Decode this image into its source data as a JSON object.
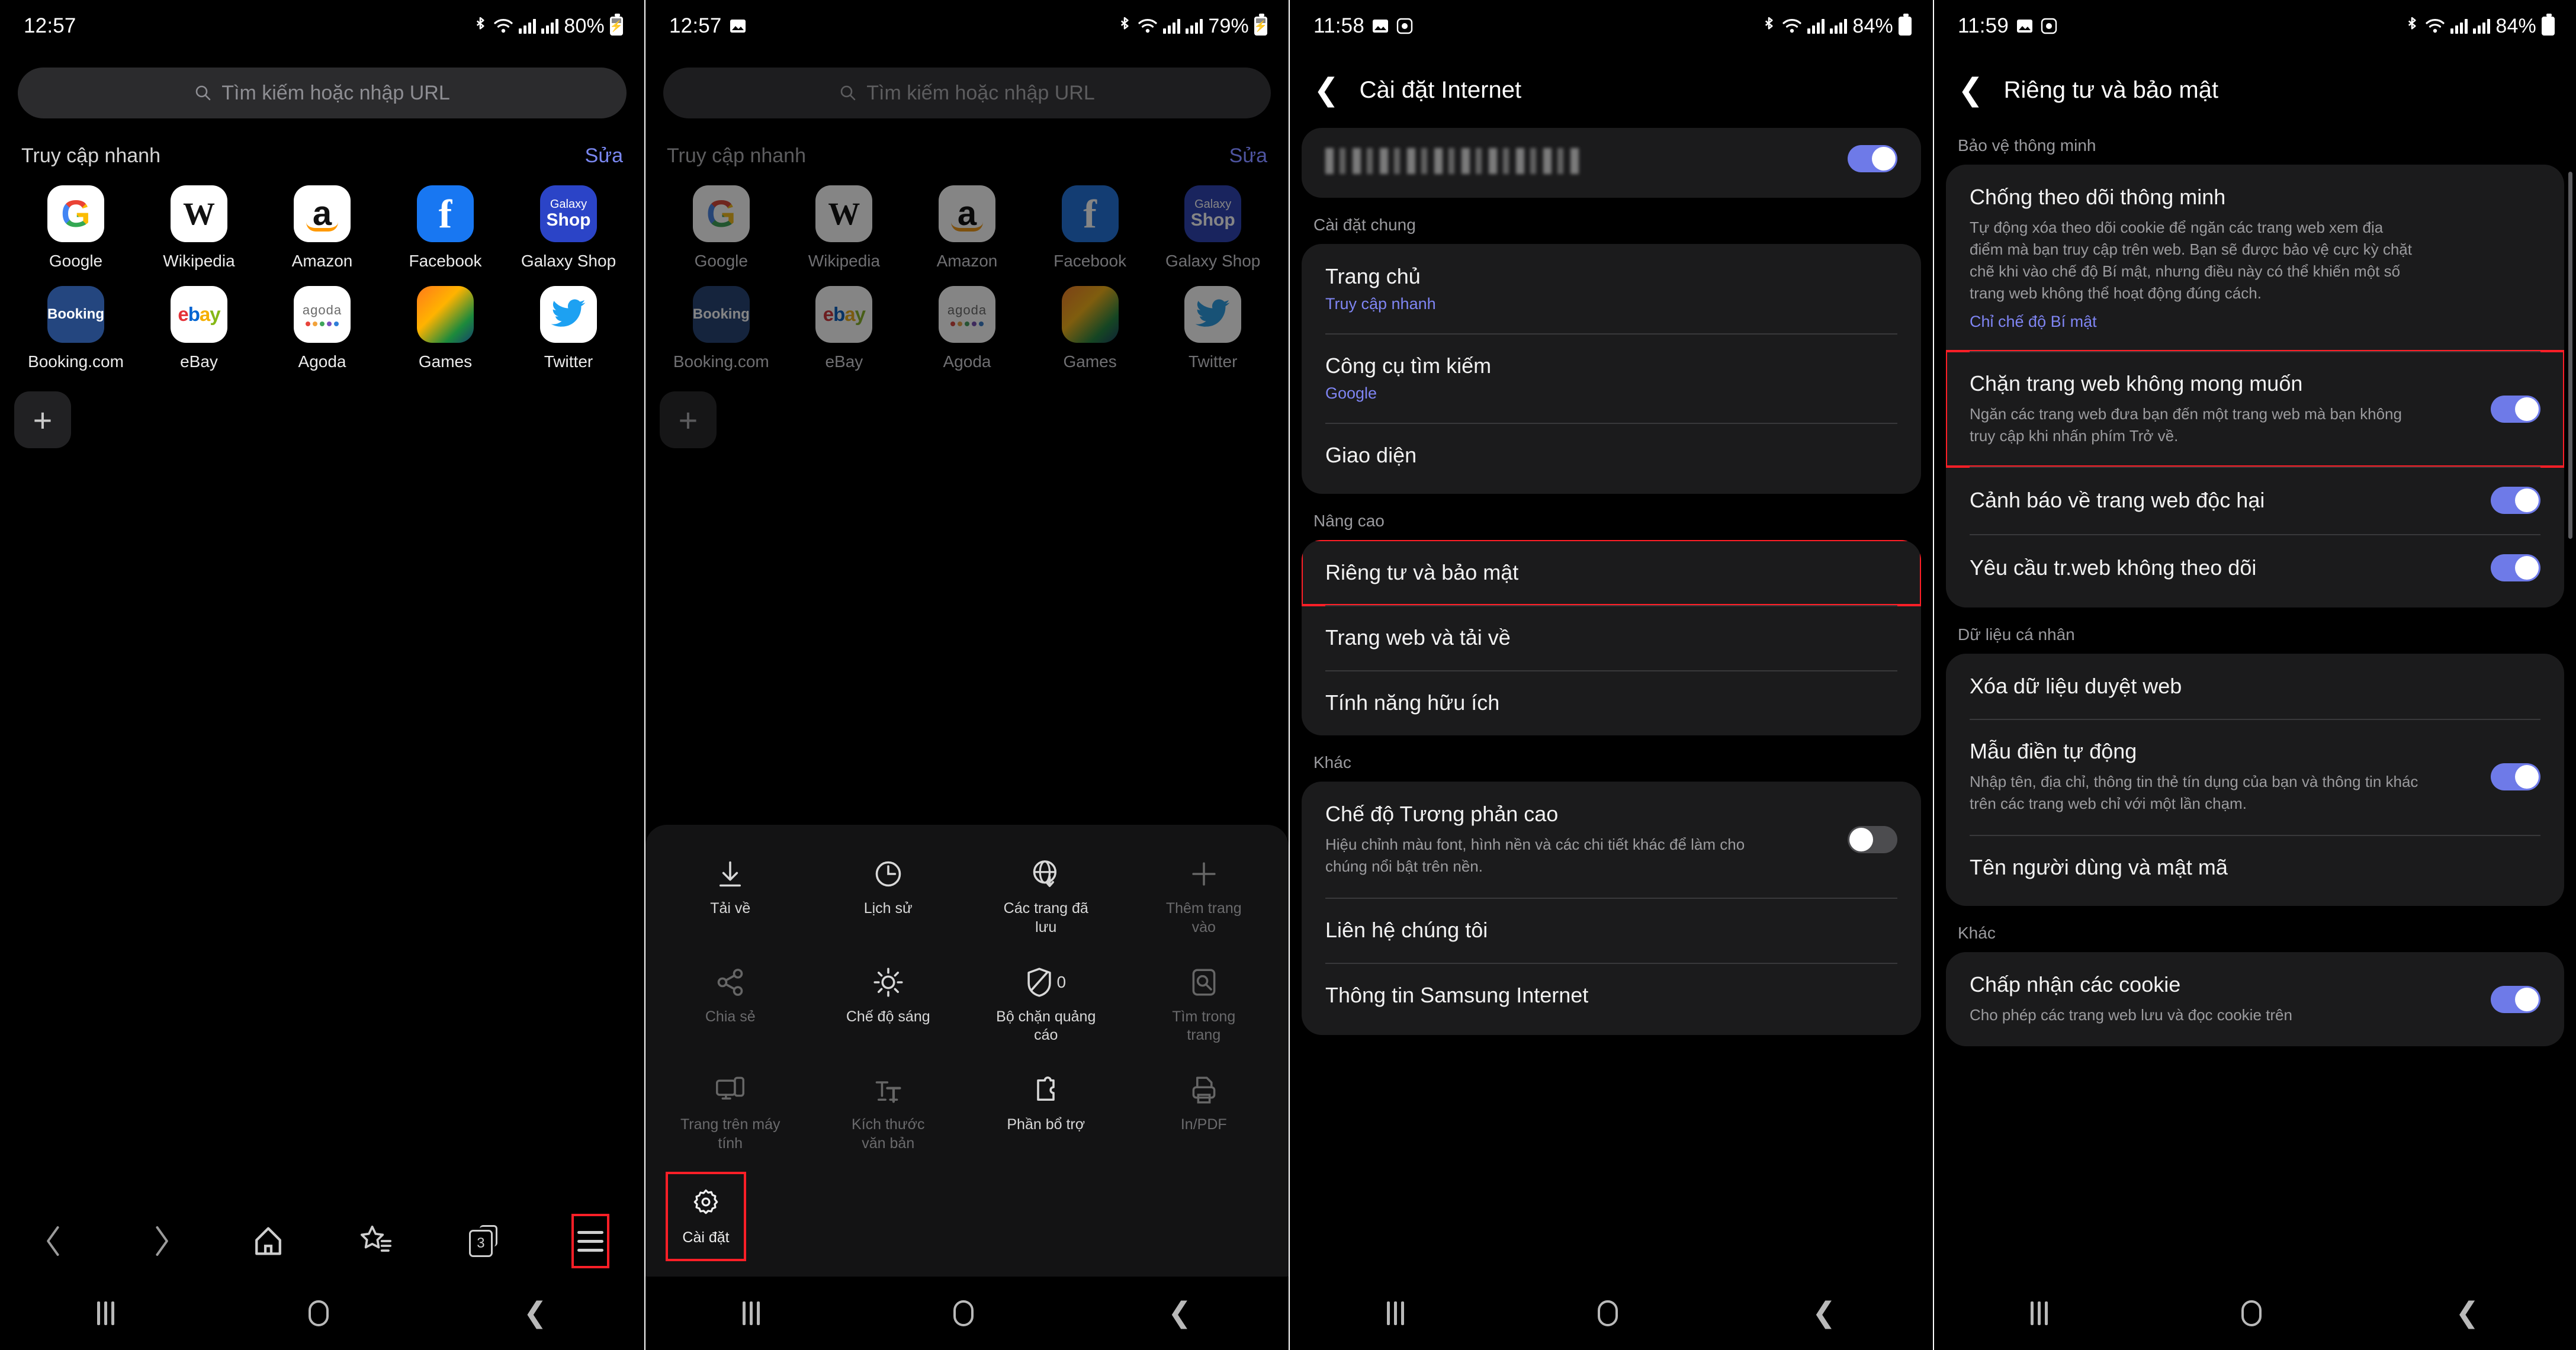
{
  "screen1": {
    "status": {
      "time": "12:57",
      "battery": "80%",
      "icons": [
        "bluetooth-icon",
        "wifi-icon",
        "signal-icon",
        "signal-icon",
        "battery-charging-icon"
      ]
    },
    "urlbar": {
      "placeholder": "Tìm kiếm hoặc nhập URL",
      "icon": "search-icon"
    },
    "quick_access": {
      "title": "Truy cập nhanh",
      "edit": "Sửa",
      "items": [
        {
          "label": "Google",
          "icon": "google-icon"
        },
        {
          "label": "Wikipedia",
          "icon": "wikipedia-icon"
        },
        {
          "label": "Amazon",
          "icon": "amazon-icon"
        },
        {
          "label": "Facebook",
          "icon": "facebook-icon"
        },
        {
          "label": "Galaxy Shop",
          "icon": "galaxy-shop-icon",
          "line1": "Galaxy",
          "line2": "Shop"
        },
        {
          "label": "Booking.com",
          "icon": "booking-icon",
          "short": "Booking"
        },
        {
          "label": "eBay",
          "icon": "ebay-icon"
        },
        {
          "label": "Agoda",
          "icon": "agoda-icon",
          "word": "agoda"
        },
        {
          "label": "Games",
          "icon": "games-icon"
        },
        {
          "label": "Twitter",
          "icon": "twitter-icon"
        }
      ],
      "add_label": "+"
    },
    "toolbar": {
      "back": "back-icon",
      "forward": "forward-icon",
      "home": "home-icon",
      "bookmarks": "bookmarks-star-icon",
      "tabs_count": "3",
      "menu": "hamburger-menu-icon"
    }
  },
  "screen2": {
    "status": {
      "time": "12:57",
      "battery": "79%"
    },
    "urlbar": {
      "placeholder": "Tìm kiếm hoặc nhập URL"
    },
    "quick_access": {
      "title": "Truy cập nhanh",
      "edit": "Sửa"
    },
    "menu_sheet": {
      "items": [
        {
          "label": "Tải về",
          "icon": "download-icon",
          "enabled": true
        },
        {
          "label": "Lịch sử",
          "icon": "history-clock-icon",
          "enabled": true
        },
        {
          "label": "Các trang đã lưu",
          "icon": "saved-pages-icon",
          "enabled": true
        },
        {
          "label": "Thêm trang vào",
          "icon": "plus-icon",
          "enabled": false
        },
        {
          "label": "Chia sẻ",
          "icon": "share-icon",
          "enabled": false
        },
        {
          "label": "Chế độ sáng",
          "icon": "brightness-sun-icon",
          "enabled": true
        },
        {
          "label": "Bộ chặn quảng cáo",
          "icon": "ad-block-shield-icon",
          "badge": "0",
          "enabled": true
        },
        {
          "label": "Tìm trong trang",
          "icon": "find-in-page-icon",
          "enabled": false
        },
        {
          "label": "Trang trên máy tính",
          "icon": "desktop-site-icon",
          "enabled": false
        },
        {
          "label": "Kích thước văn bản",
          "icon": "text-size-icon",
          "enabled": false
        },
        {
          "label": "Phần bổ trợ",
          "icon": "add-ons-icon",
          "enabled": true
        },
        {
          "label": "In/PDF",
          "icon": "print-pdf-icon",
          "enabled": false
        }
      ],
      "settings": {
        "label": "Cài đặt",
        "icon": "gear-icon",
        "highlighted": true
      }
    }
  },
  "screen3": {
    "status": {
      "time": "11:58",
      "battery": "84%"
    },
    "header": {
      "title": "Cài đặt Internet",
      "back": "back-chevron-icon"
    },
    "account_row": {
      "redacted": true,
      "toggle_on": true
    },
    "sections": [
      {
        "label": "Cài đặt chung",
        "rows": [
          {
            "title": "Trang chủ",
            "sub": "Truy cập nhanh"
          },
          {
            "title": "Công cụ tìm kiếm",
            "sub": "Google"
          },
          {
            "title": "Giao diện"
          }
        ]
      },
      {
        "label": "Nâng cao",
        "rows": [
          {
            "title": "Riêng tư và bảo mật",
            "highlighted": true
          },
          {
            "title": "Trang web và tải về"
          },
          {
            "title": "Tính năng hữu ích"
          }
        ]
      },
      {
        "label": "Khác",
        "rows": [
          {
            "title": "Chế độ Tương phản cao",
            "desc": "Hiệu chỉnh màu font, hình nền và các chi tiết khác để làm cho chúng nổi bật trên nền.",
            "toggle": false
          },
          {
            "title": "Liên hệ chúng tôi"
          },
          {
            "title": "Thông tin Samsung Internet"
          }
        ]
      }
    ]
  },
  "screen4": {
    "status": {
      "time": "11:59",
      "battery": "84%"
    },
    "header": {
      "title": "Riêng tư và bảo mật",
      "back": "back-chevron-icon"
    },
    "sections": [
      {
        "label": "Bảo vệ thông minh",
        "rows": [
          {
            "title": "Chống theo dõi thông minh",
            "desc": "Tự động xóa theo dõi cookie để ngăn các trang web xem địa điểm mà bạn truy cập trên web. Bạn sẽ được bảo vệ cực kỳ chặt chẽ khi vào chế độ Bí mật, nhưng điều này có thể khiến một số trang web không thể hoạt động đúng cách.",
            "link": "Chỉ chế độ Bí mật"
          },
          {
            "title": "Chặn trang web không mong muốn",
            "desc": "Ngăn các trang web đưa bạn đến một trang web mà bạn không truy cập khi nhấn phím Trở về.",
            "toggle": true,
            "highlighted": true
          },
          {
            "title": "Cảnh báo về trang web độc hại",
            "toggle": true
          },
          {
            "title": "Yêu cầu tr.web không theo dõi",
            "toggle": true
          }
        ]
      },
      {
        "label": "Dữ liệu cá nhân",
        "rows": [
          {
            "title": "Xóa dữ liệu duyệt web"
          },
          {
            "title": "Mẫu điền tự động",
            "desc": "Nhập tên, địa chỉ, thông tin thẻ tín dụng của bạn và thông tin khác trên các trang web chỉ với một lần chạm.",
            "toggle": true
          },
          {
            "title": "Tên người dùng và mật mã"
          }
        ]
      },
      {
        "label": "Khác",
        "rows": [
          {
            "title": "Chấp nhận các cookie",
            "desc": "Cho phép các trang web lưu và đọc cookie trên",
            "toggle": true
          }
        ]
      }
    ]
  },
  "android_nav": {
    "recent": "recent-apps-icon",
    "home": "home-button-icon",
    "back": "back-button-icon"
  }
}
